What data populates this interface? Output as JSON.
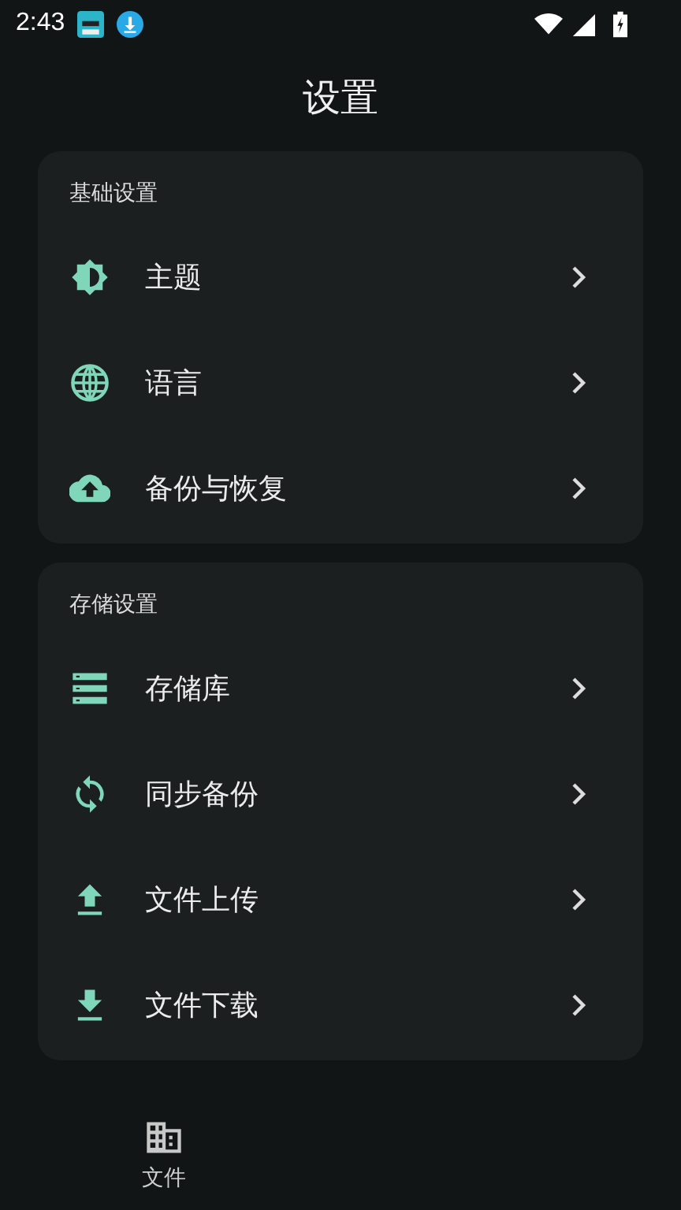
{
  "status_bar": {
    "time": "2:43"
  },
  "title": "设置",
  "sections": [
    {
      "header": "基础设置",
      "items": [
        {
          "label": "主题"
        },
        {
          "label": "语言"
        },
        {
          "label": "备份与恢复"
        }
      ]
    },
    {
      "header": "存储设置",
      "items": [
        {
          "label": "存储库"
        },
        {
          "label": "同步备份"
        },
        {
          "label": "文件上传"
        },
        {
          "label": "文件下载"
        }
      ]
    }
  ],
  "bottom_nav": [
    {
      "label": "文件"
    }
  ]
}
